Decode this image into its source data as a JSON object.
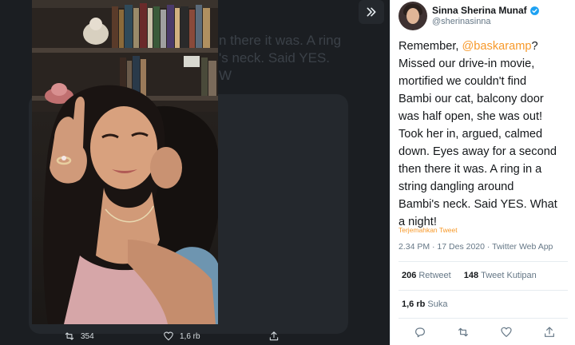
{
  "viewer": {
    "background_text": [
      "n there it was. A ring",
      "'s neck. Said YES.",
      "W"
    ],
    "next_icon": "chevron-double-right-icon",
    "actions": {
      "retweet_count": "354",
      "like_count": "1,6 rb"
    }
  },
  "tweet": {
    "author_name": "Sinna Sherina Munaf",
    "handle": "@sherinasinna",
    "verified": true,
    "body_start": "Remember, ",
    "mention": "@baskaramp",
    "body_first_line_end": "?",
    "body_lines": [
      "Missed our drive-in movie,",
      "mortified we couldn't find",
      "Bambi our cat, balcony door",
      "was half open, she was out!",
      "Took her in, argued, calmed",
      "down. Eyes away for a second",
      "then there it was. A ring in a",
      "string dangling around",
      "Bambi's neck. Said YES. What",
      "a night!"
    ],
    "translate_label": "Terjemahkan Tweet",
    "meta": "2.34 PM · 17 Des 2020 · Twitter Web App",
    "retweets": {
      "count": "206",
      "label": "Retweet"
    },
    "quotes": {
      "count": "148",
      "label": "Tweet Kutipan"
    },
    "likes": {
      "count": "1,6 rb",
      "label": "Suka"
    }
  },
  "colors": {
    "accent": "#f7992a",
    "verified_badge": "#1da1f2",
    "viewer_bg": "#1b1e22"
  }
}
